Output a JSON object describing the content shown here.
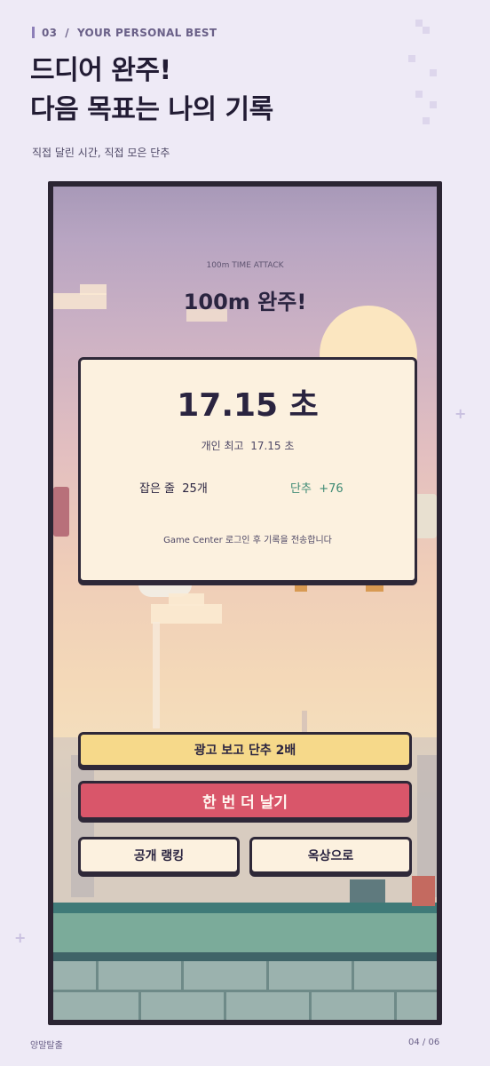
{
  "header": {
    "section_number": "03",
    "separator": "/",
    "section_label": "YOUR PERSONAL BEST",
    "title_line1": "드디어 완주!",
    "title_line2": "다음 목표는 나의 기록",
    "subtitle": "직접 달린 시간, 직접 모은 단추"
  },
  "game": {
    "mode_label": "100m TIME ATTACK",
    "result_title": "100m 완주!",
    "time_value": "17.15 초",
    "best_label": "개인 최고",
    "best_value": "17.15 초",
    "caught_label": "잡은 줄",
    "caught_value": "25개",
    "buttons_label": "단추",
    "buttons_value": "+76",
    "login_notice": "Game Center 로그인 후 기록을 전송합니다",
    "ad_button_label": "광고 보고 단추 2배",
    "retry_button_label": "한 번 더 날기",
    "ranking_button_label": "공개 랭킹",
    "rooftop_button_label": "옥상으로"
  },
  "footer": {
    "app_name": "양말탈출",
    "page_indicator": "04 / 06"
  },
  "colors": {
    "accent_purple": "#8d7fb8",
    "retry_red": "#d9566a",
    "ad_yellow": "#f6d98a",
    "buttons_green": "#3e8a74",
    "card_cream": "#fcf1df"
  }
}
